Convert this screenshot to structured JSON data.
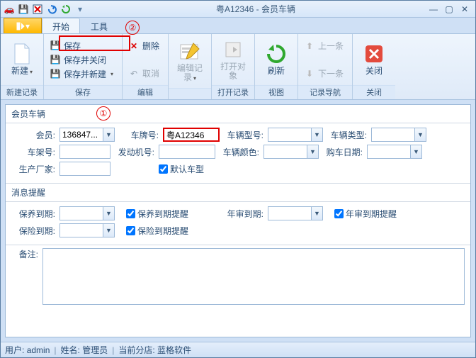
{
  "window": {
    "title": "粤A12346 - 会员车辆"
  },
  "qat": {
    "icons": [
      "car-icon",
      "save-icon",
      "delete-icon",
      "undo-icon",
      "refresh-icon",
      "dropdown-icon"
    ]
  },
  "tabs": {
    "start": "开始",
    "tools": "工具"
  },
  "annotations": {
    "one": "①",
    "two": "②"
  },
  "ribbon": {
    "new_record": {
      "label": "新建",
      "group": "新建记录"
    },
    "save_group": {
      "save": "保存",
      "save_close": "保存并关闭",
      "save_new": "保存并新建",
      "group": "保存"
    },
    "edit_group": {
      "delete": "删除",
      "cancel": "取消",
      "group": "编辑"
    },
    "edit_record": {
      "label": "编辑记录"
    },
    "open_object": {
      "label": "打开对象",
      "group": "打开记录"
    },
    "refresh": {
      "label": "刷新",
      "group": "视图"
    },
    "nav_group": {
      "prev": "上一条",
      "next": "下一条",
      "group": "记录导航"
    },
    "close": {
      "label": "关闭",
      "group": "关闭"
    }
  },
  "panel1": {
    "title": "会员车辆",
    "member_label": "会员:",
    "member_value": "136847...",
    "plate_label": "车牌号:",
    "plate_value": "粤A12346",
    "model_label": "车辆型号:",
    "type_label": "车辆类型:",
    "vin_label": "车架号:",
    "engine_label": "发动机号:",
    "color_label": "车辆颜色:",
    "buy_date_label": "购车日期:",
    "maker_label": "生产厂家:",
    "default_model_chk": "默认车型"
  },
  "panel2": {
    "title": "消息提醒",
    "maint_due_label": "保养到期:",
    "maint_chk": "保养到期提醒",
    "inspect_due_label": "年审到期:",
    "inspect_chk": "年审到期提醒",
    "ins_due_label": "保险到期:",
    "ins_chk": "保险到期提醒"
  },
  "notes": {
    "label": "备注:"
  },
  "status": {
    "user_label": "用户:",
    "user_value": "admin",
    "name_label": "姓名:",
    "name_value": "管理员",
    "store_label": "当前分店:",
    "store_value": "蓝格软件"
  }
}
